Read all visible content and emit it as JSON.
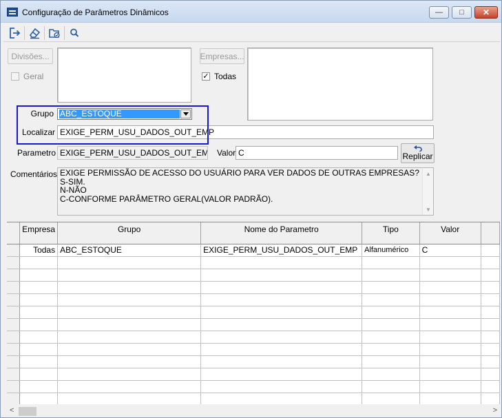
{
  "window": {
    "title": "Configuração de Parâmetros Dinâmicos",
    "minimize": "—",
    "maximize": "□",
    "close": "✕"
  },
  "toolbar": {
    "items": [
      "exit-icon",
      "eraser-icon",
      "folder-check-icon",
      "search-icon"
    ]
  },
  "divisions": {
    "button_label": "Divisões...",
    "general_label": "Geral",
    "general_checked": false
  },
  "companies": {
    "button_label": "Empresas...",
    "all_label": "Todas",
    "all_checked": true,
    "check_mark": "✓"
  },
  "filters": {
    "group_label": "Grupo",
    "group_value": "ABC_ESTOQUE",
    "find_label": "Localizar",
    "find_value": "EXIGE_PERM_USU_DADOS_OUT_EMP"
  },
  "parameter": {
    "label": "Parametro",
    "value": "EXIGE_PERM_USU_DADOS_OUT_EMP",
    "value_label": "Valor",
    "value_value": "C",
    "replicate_label": "Replicar"
  },
  "comments": {
    "label": "Comentários",
    "lines": [
      "EXIGE PERMISSÃO DE ACESSO DO USUÁRIO PARA VER DADOS DE OUTRAS EMPRESAS?",
      "S-SIM.",
      "N-NÃO",
      "C-CONFORME PARÂMETRO GERAL(VALOR PADRÃO)."
    ]
  },
  "grid": {
    "columns": [
      "Empresa",
      "Grupo",
      "Nome do Parametro",
      "Tipo",
      "Valor"
    ],
    "rows": [
      [
        "Todas",
        "ABC_ESTOQUE",
        "EXIGE_PERM_USU_DADOS_OUT_EMP",
        "Alfanumérico",
        "C"
      ]
    ]
  },
  "colors": {
    "selection": "#3399ff",
    "focus_border": "#1a16d6",
    "close_button": "#c4412a"
  }
}
